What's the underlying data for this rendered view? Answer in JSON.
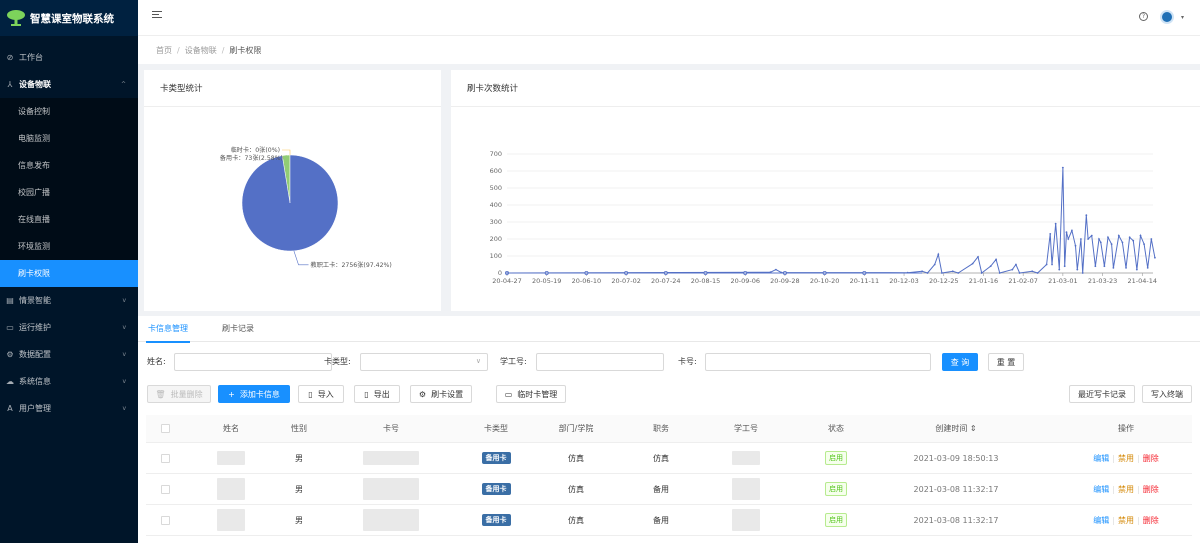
{
  "app": {
    "title": "智慧课室物联系统"
  },
  "sidebar": {
    "items": [
      {
        "label": "工作台",
        "icon": "dashboard-icon"
      },
      {
        "label": "设备物联",
        "icon": "network-icon",
        "open": true,
        "children": [
          {
            "label": "设备控制"
          },
          {
            "label": "电脑监测"
          },
          {
            "label": "信息发布"
          },
          {
            "label": "校园广播"
          },
          {
            "label": "在线直播"
          },
          {
            "label": "环境监测"
          },
          {
            "label": "刷卡权限",
            "active": true
          }
        ]
      },
      {
        "label": "情景智能",
        "icon": "scene-icon"
      },
      {
        "label": "运行维护",
        "icon": "monitor-icon"
      },
      {
        "label": "数据配置",
        "icon": "gear-icon"
      },
      {
        "label": "系统信息",
        "icon": "cloud-icon"
      },
      {
        "label": "用户管理",
        "icon": "user-icon"
      }
    ]
  },
  "breadcrumb": [
    "首页",
    "设备物联",
    "刷卡权限"
  ],
  "pie_card": {
    "title": "卡类型统计"
  },
  "line_card": {
    "title": "刷卡次数统计"
  },
  "chart_data": [
    {
      "type": "pie",
      "title": "卡类型统计",
      "slices": [
        {
          "name": "教职工卡",
          "label": "教职工卡：2756张(97.42%)",
          "value": 2756,
          "percent": 97.42,
          "color": "#5470c6"
        },
        {
          "name": "备用卡",
          "label": "备用卡：73张(2.58%)",
          "value": 73,
          "percent": 2.58,
          "color": "#91cc75"
        },
        {
          "name": "临时卡",
          "label": "临时卡：0张(0%)",
          "value": 0,
          "percent": 0,
          "color": "#fac858"
        }
      ]
    },
    {
      "type": "line",
      "title": "刷卡次数统计",
      "color": "#5470c6",
      "ylim": [
        0,
        700
      ],
      "yticks": [
        0,
        100,
        200,
        300,
        400,
        500,
        600,
        700
      ],
      "xticks": [
        "20-04-27",
        "20-05-19",
        "20-06-10",
        "20-07-02",
        "20-07-24",
        "20-08-15",
        "20-09-06",
        "20-09-28",
        "20-10-20",
        "20-11-11",
        "20-12-03",
        "20-12-25",
        "21-01-16",
        "21-02-07",
        "21-03-01",
        "21-03-23",
        "21-04-14"
      ],
      "grid": true,
      "points": [
        [
          "20-04-27",
          0
        ],
        [
          "20-09-20",
          5
        ],
        [
          "20-09-23",
          20
        ],
        [
          "20-09-26",
          3
        ],
        [
          "20-12-05",
          2
        ],
        [
          "20-12-13",
          10
        ],
        [
          "20-12-16",
          0
        ],
        [
          "20-12-20",
          50
        ],
        [
          "20-12-22",
          110
        ],
        [
          "20-12-24",
          0
        ],
        [
          "20-12-30",
          10
        ],
        [
          "21-01-02",
          0
        ],
        [
          "21-01-10",
          55
        ],
        [
          "21-01-13",
          95
        ],
        [
          "21-01-15",
          0
        ],
        [
          "21-01-20",
          40
        ],
        [
          "21-01-23",
          80
        ],
        [
          "21-01-25",
          0
        ],
        [
          "21-02-01",
          20
        ],
        [
          "21-02-03",
          50
        ],
        [
          "21-02-05",
          0
        ],
        [
          "21-02-12",
          10
        ],
        [
          "21-02-15",
          0
        ],
        [
          "21-02-20",
          50
        ],
        [
          "21-02-22",
          230
        ],
        [
          "21-02-23",
          50
        ],
        [
          "21-02-25",
          290
        ],
        [
          "21-02-27",
          20
        ],
        [
          "21-03-01",
          620
        ],
        [
          "21-03-02",
          40
        ],
        [
          "21-03-03",
          240
        ],
        [
          "21-03-04",
          200
        ],
        [
          "21-03-06",
          250
        ],
        [
          "21-03-08",
          160
        ],
        [
          "21-03-09",
          20
        ],
        [
          "21-03-11",
          200
        ],
        [
          "21-03-12",
          0
        ],
        [
          "21-03-14",
          340
        ],
        [
          "21-03-15",
          200
        ],
        [
          "21-03-17",
          220
        ],
        [
          "21-03-19",
          40
        ],
        [
          "21-03-21",
          200
        ],
        [
          "21-03-22",
          180
        ],
        [
          "21-03-24",
          40
        ],
        [
          "21-03-26",
          210
        ],
        [
          "21-03-28",
          170
        ],
        [
          "21-03-29",
          30
        ],
        [
          "21-04-01",
          220
        ],
        [
          "21-04-03",
          180
        ],
        [
          "21-04-05",
          30
        ],
        [
          "21-04-07",
          210
        ],
        [
          "21-04-09",
          190
        ],
        [
          "21-04-11",
          20
        ],
        [
          "21-04-13",
          220
        ],
        [
          "21-04-15",
          170
        ],
        [
          "21-04-17",
          30
        ],
        [
          "21-04-19",
          200
        ],
        [
          "21-04-21",
          90
        ]
      ]
    }
  ],
  "tabs": [
    "卡信息管理",
    "刷卡记录"
  ],
  "filters": {
    "name_label": "姓名:",
    "card_type_label": "卡类型:",
    "student_no_label": "学工号:",
    "card_no_label": "卡号:",
    "search_label": "查 询",
    "reset_label": "重 置"
  },
  "toolbar": {
    "batch_delete": "批量删除",
    "add": "添加卡信息",
    "import": "导入",
    "export": "导出",
    "card_settings": "刷卡设置",
    "temp_card": "临时卡管理",
    "recent": "最近写卡记录",
    "write_terminal": "写入终端"
  },
  "table": {
    "headers": [
      "姓名",
      "性别",
      "卡号",
      "卡类型",
      "部门/学院",
      "职务",
      "学工号",
      "状态",
      "创建时间 ⇕",
      "操作"
    ],
    "rows": [
      {
        "gender": "男",
        "card_type": "备用卡",
        "dept": "仿真",
        "position": "仿真",
        "status": "启用",
        "created": "2021-03-09 18:50:13"
      },
      {
        "gender": "男",
        "card_type": "备用卡",
        "dept": "仿真",
        "position": "备用",
        "status": "启用",
        "created": "2021-03-08 11:32:17"
      },
      {
        "gender": "男",
        "card_type": "备用卡",
        "dept": "仿真",
        "position": "备用",
        "status": "启用",
        "created": "2021-03-08 11:32:17"
      }
    ],
    "ops": {
      "edit": "编辑",
      "disable": "禁用",
      "delete": "删除"
    }
  },
  "colors": {
    "primary": "#1890ff",
    "sidebar": "#001529",
    "pie_main": "#5470c6",
    "pie_alt": "#91cc75"
  }
}
